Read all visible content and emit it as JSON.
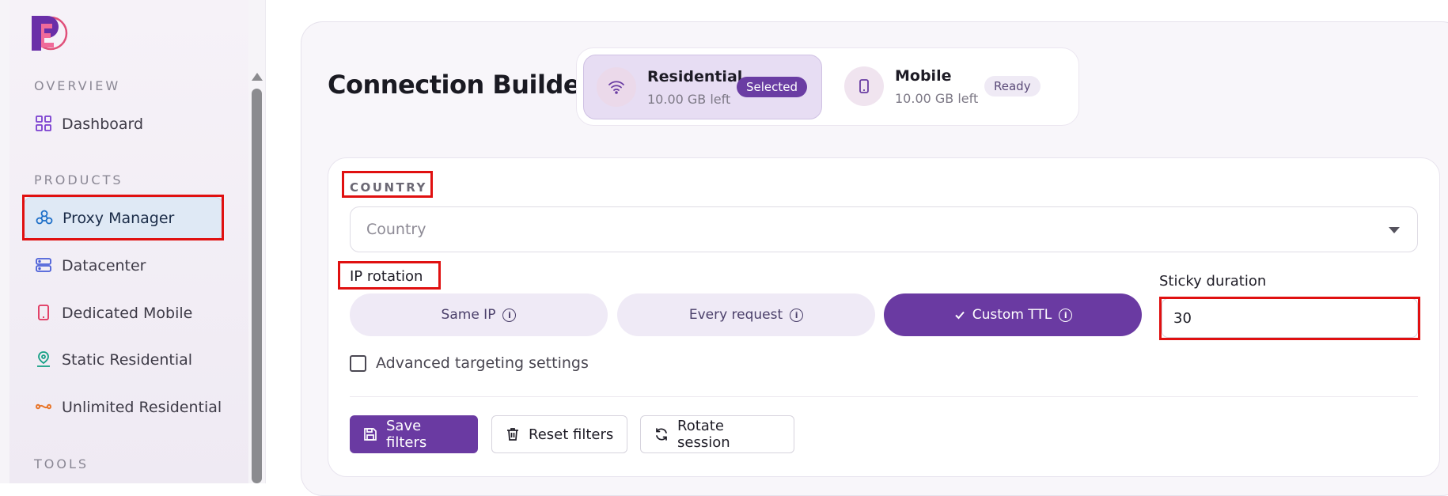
{
  "sidebar": {
    "sections": {
      "overview": "OVERVIEW",
      "products": "PRODUCTS",
      "tools": "TOOLS"
    },
    "items": [
      {
        "label": "Dashboard",
        "icon": "grid-icon"
      },
      {
        "label": "Proxy Manager",
        "icon": "network-icon",
        "active": true
      },
      {
        "label": "Datacenter",
        "icon": "server-icon"
      },
      {
        "label": "Dedicated Mobile",
        "icon": "phone-icon"
      },
      {
        "label": "Static Residential",
        "icon": "location-person-icon"
      },
      {
        "label": "Unlimited Residential",
        "icon": "infinity-icon"
      }
    ]
  },
  "header": {
    "title": "Connection Builder"
  },
  "pools": [
    {
      "name": "Residential",
      "remaining": "10.00 GB left",
      "badge": "Selected",
      "icon": "wifi-icon"
    },
    {
      "name": "Mobile",
      "remaining": "10.00 GB left",
      "badge": "Ready",
      "icon": "phone-icon"
    }
  ],
  "form": {
    "country_label": "COUNTRY",
    "country_placeholder": "Country",
    "ip_rotation_label": "IP rotation",
    "rotation_options": [
      {
        "label": "Same IP"
      },
      {
        "label": "Every request"
      },
      {
        "label": "Custom TTL",
        "active": true
      }
    ],
    "sticky_label": "Sticky duration",
    "sticky_value": "30",
    "advanced_label": "Advanced targeting settings",
    "actions": {
      "save": "Save filters",
      "reset": "Reset filters",
      "rotate": "Rotate session"
    }
  },
  "colors": {
    "accent": "#6a3aa2",
    "highlight": "#e01010",
    "active_nav": "#dfe9f5"
  }
}
